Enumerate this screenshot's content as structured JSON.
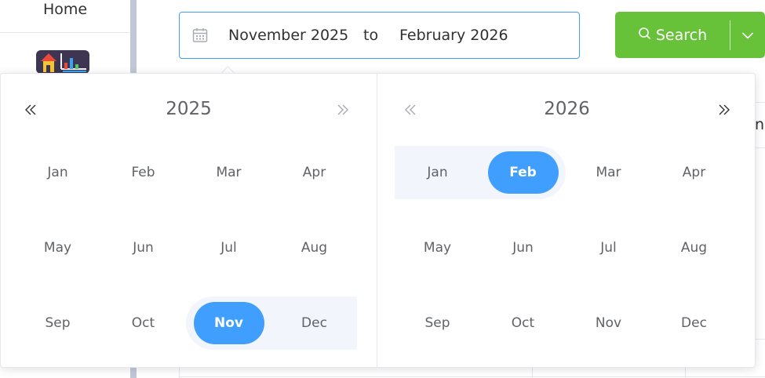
{
  "sidebar": {
    "home_label": "Home",
    "app_icon": "house-chart-icon"
  },
  "date_range": {
    "start": "November 2025",
    "separator": "to",
    "end": "February 2026",
    "icon": "calendar-icon"
  },
  "search_button": {
    "label": "Search",
    "icon": "search-icon",
    "dropdown_icon": "chevron-down-icon"
  },
  "background": {
    "partial_header": "nc"
  },
  "picker": {
    "left": {
      "year": "2025",
      "prev_icon": "double-chevron-left-icon",
      "next_icon": "double-chevron-right-icon",
      "months": [
        "Jan",
        "Feb",
        "Mar",
        "Apr",
        "May",
        "Jun",
        "Jul",
        "Aug",
        "Sep",
        "Oct",
        "Nov",
        "Dec"
      ],
      "selected_index": 10,
      "in_range_indices": [
        10,
        11
      ]
    },
    "right": {
      "year": "2026",
      "prev_icon": "double-chevron-left-icon",
      "next_icon": "double-chevron-right-icon",
      "months": [
        "Jan",
        "Feb",
        "Mar",
        "Apr",
        "May",
        "Jun",
        "Jul",
        "Aug",
        "Sep",
        "Oct",
        "Nov",
        "Dec"
      ],
      "selected_index": 1,
      "in_range_indices": [
        0,
        1
      ]
    }
  },
  "colors": {
    "primary": "#409eff",
    "success": "#67c23a",
    "range_band": "#f2f6fc",
    "text": "#606266"
  }
}
